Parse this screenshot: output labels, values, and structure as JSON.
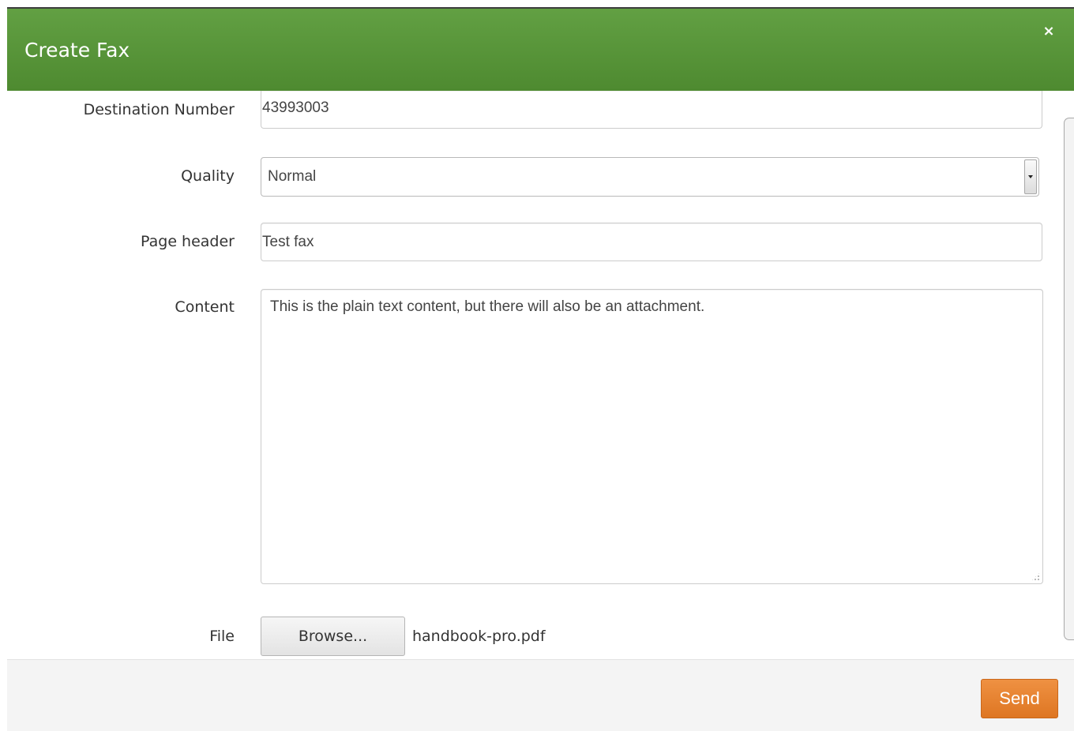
{
  "dialog": {
    "title": "Create Fax",
    "close_label": "×"
  },
  "form": {
    "destination": {
      "label": "Destination Number",
      "value": "43993003"
    },
    "quality": {
      "label": "Quality",
      "value": "Normal"
    },
    "page_header": {
      "label": "Page header",
      "value": "Test fax"
    },
    "content": {
      "label": "Content",
      "value": "This is the plain text content, but there will also be an attachment."
    },
    "file": {
      "label": "File",
      "browse_label": "Browse...",
      "file_name": "handbook-pro.pdf"
    }
  },
  "footer": {
    "send_label": "Send"
  },
  "colors": {
    "header_green": "#5a9a3c",
    "send_orange": "#e7832f",
    "footer_bg": "#f4f4f4"
  }
}
